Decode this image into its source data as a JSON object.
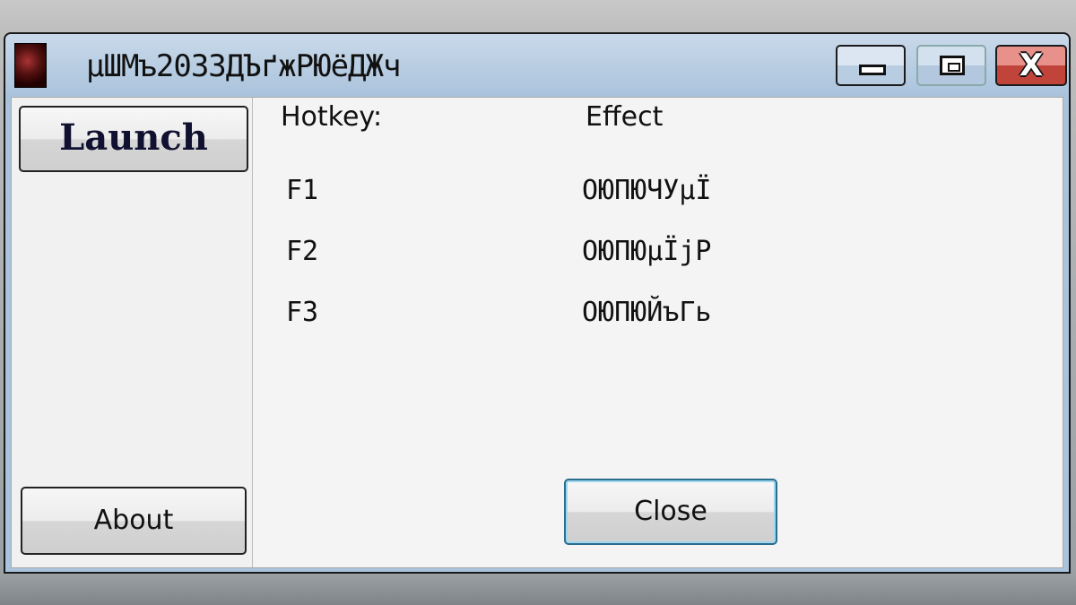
{
  "window": {
    "title": "µШМъ2033ДЪґжРЮёДЖч",
    "controls": {
      "minimize": "minimize",
      "maximize": "maximize",
      "close": "X"
    }
  },
  "sidebar": {
    "launch_label": "Launch",
    "about_label": "About"
  },
  "table": {
    "headers": {
      "hotkey": "Hotkey:",
      "effect": "Effect"
    },
    "rows": [
      {
        "hotkey": "F1",
        "effect": "ОЮПЮЧУµЇ"
      },
      {
        "hotkey": "F2",
        "effect": "ОЮПЮµЇјР"
      },
      {
        "hotkey": "F3",
        "effect": "ОЮПЮЙъГь"
      }
    ]
  },
  "footer": {
    "close_label": "Close"
  }
}
